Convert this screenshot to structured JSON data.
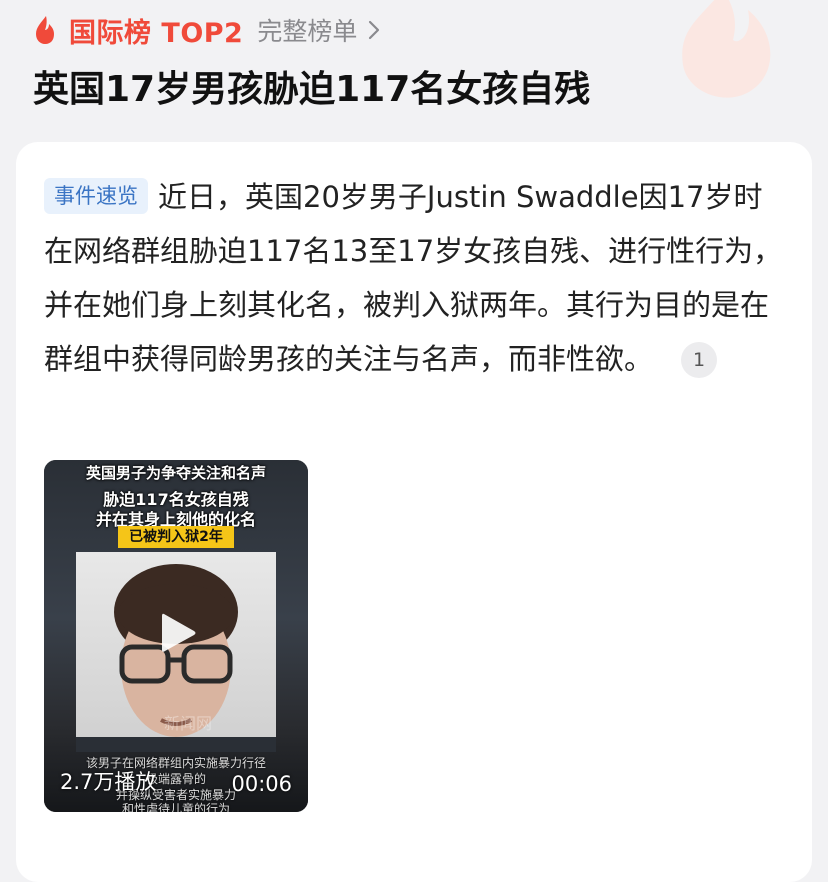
{
  "header": {
    "rank_label": "国际榜 TOP2",
    "full_list_link": "完整榜单",
    "headline": "英国17岁男孩胁迫117名女孩自残"
  },
  "card": {
    "tag": "事件速览",
    "summary": "近日，英国20岁男子Justin Swaddle因17岁时在网络群组胁迫117名13至17岁女孩自残、进行性行为，并在她们身上刻其化名，被判入狱两年。其行为目的是在群组中获得同龄男孩的关注与名声，而非性欲。",
    "reference_number": "1"
  },
  "video": {
    "overlay_line1": "英国男子为争夺关注和名声",
    "overlay_line2": "胁迫117名女孩自残",
    "overlay_line3": "并在其身上刻他的化名",
    "overlay_badge": "已被判入狱2年",
    "caption_line1": "该男子在网络群组内实施暴力行径",
    "caption_line2": "极端露骨的",
    "caption_line3": "并操纵受害者实施暴力",
    "caption_line4": "和性虐待儿童的行为",
    "watermark": "新闻网",
    "views": "2.7万播放",
    "duration": "00:06"
  },
  "icons": {
    "fire": "fire-icon",
    "chevron": "chevron-right-icon",
    "play": "play-icon"
  },
  "colors": {
    "accent_red": "#f04a3a",
    "tag_blue": "#3a74c4",
    "tag_bg": "#e8f1fc"
  }
}
